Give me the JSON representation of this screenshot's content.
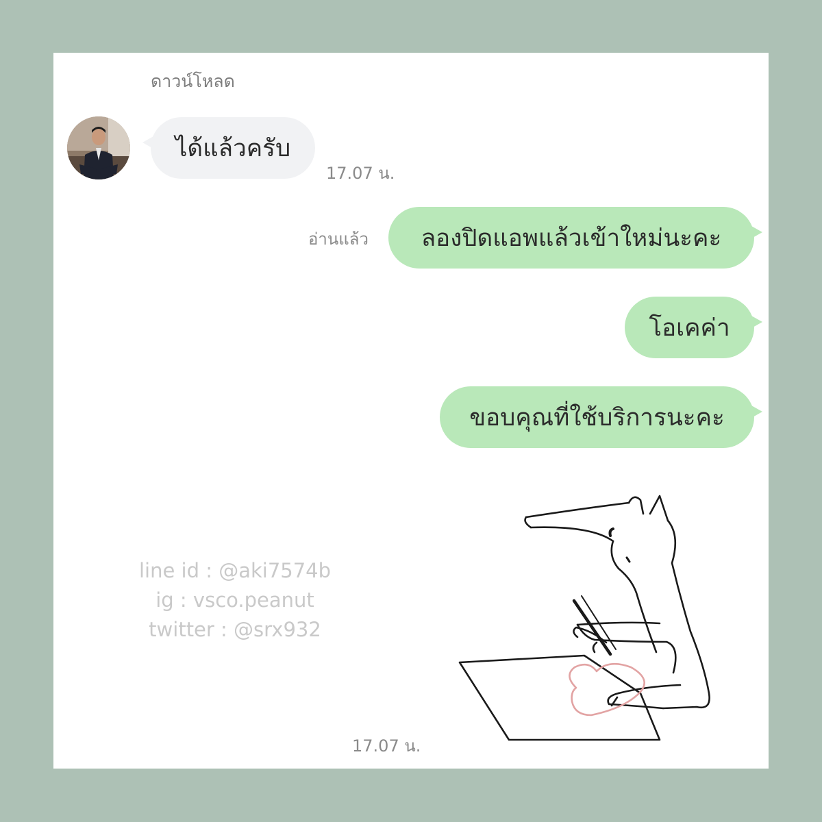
{
  "chat": {
    "sender_name": "ดาวน์โหลด",
    "messages": [
      {
        "direction": "incoming",
        "text": "ได้แล้วครับ",
        "time": "17.07 น."
      },
      {
        "direction": "outgoing",
        "text": "ลองปิดแอพแล้วเข้าใหม่นะคะ",
        "read_label": "อ่านแล้ว"
      },
      {
        "direction": "outgoing",
        "text": "โอเคค่า"
      },
      {
        "direction": "outgoing",
        "text": "ขอบคุณที่ใช้บริการนะคะ"
      }
    ],
    "sticker": {
      "icon": "fox-drawing-heart-sticker",
      "time": "17.07 น."
    }
  },
  "contact": {
    "line": "line id : @aki7574b",
    "ig": "ig : vsco.peanut",
    "twitter": "twitter : @srx932"
  },
  "colors": {
    "frame": "#adc1b5",
    "incoming_bubble": "#f1f2f4",
    "outgoing_bubble": "#b9e8b9",
    "heart": "#e2a3a3"
  }
}
